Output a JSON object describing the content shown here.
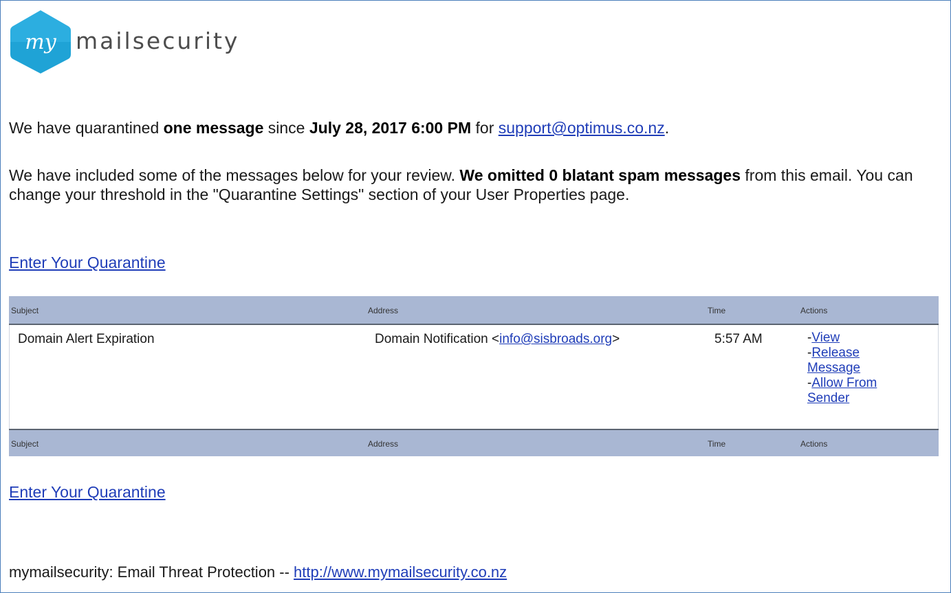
{
  "logo": {
    "mark": "my",
    "brand": "mailsecurity"
  },
  "intro": {
    "pre": "We have quarantined ",
    "count_text": "one message",
    "mid": " since ",
    "since": "July 28, 2017 6:00 PM",
    "for": " for ",
    "email": "support@optimus.co.nz",
    "end": "."
  },
  "review": {
    "pre": "We have included some of the messages below for your review. ",
    "omitted": "We omitted 0 blatant spam messages",
    "post": " from this email. You can change your threshold in the \"Quarantine Settings\" section of your User Properties page."
  },
  "enter_link": "Enter Your Quarantine",
  "table": {
    "headers": {
      "subject": "Subject",
      "address": "Address",
      "time": "Time",
      "actions": "Actions"
    },
    "rows": [
      {
        "subject": "Domain Alert Expiration",
        "address_name": "Domain Notification <",
        "address_email": "info@sisbroads.org",
        "address_end": ">",
        "time": "5:57 AM",
        "actions": [
          {
            "prefix": "-",
            "label": "View"
          },
          {
            "prefix": "-",
            "label": "Release"
          },
          {
            "prefix": "",
            "label": "Message"
          },
          {
            "prefix": "-",
            "label": "Allow From"
          },
          {
            "prefix": "",
            "label": "Sender"
          }
        ]
      }
    ]
  },
  "footer": {
    "text": "mymailsecurity: Email Threat Protection -- ",
    "url": "http://www.mymailsecurity.co.nz"
  },
  "colors": {
    "header_bg": "#a9b7d3",
    "link": "#1f3db8",
    "logo_hex": "#1fa3d6",
    "border": "#4a7ebb"
  }
}
